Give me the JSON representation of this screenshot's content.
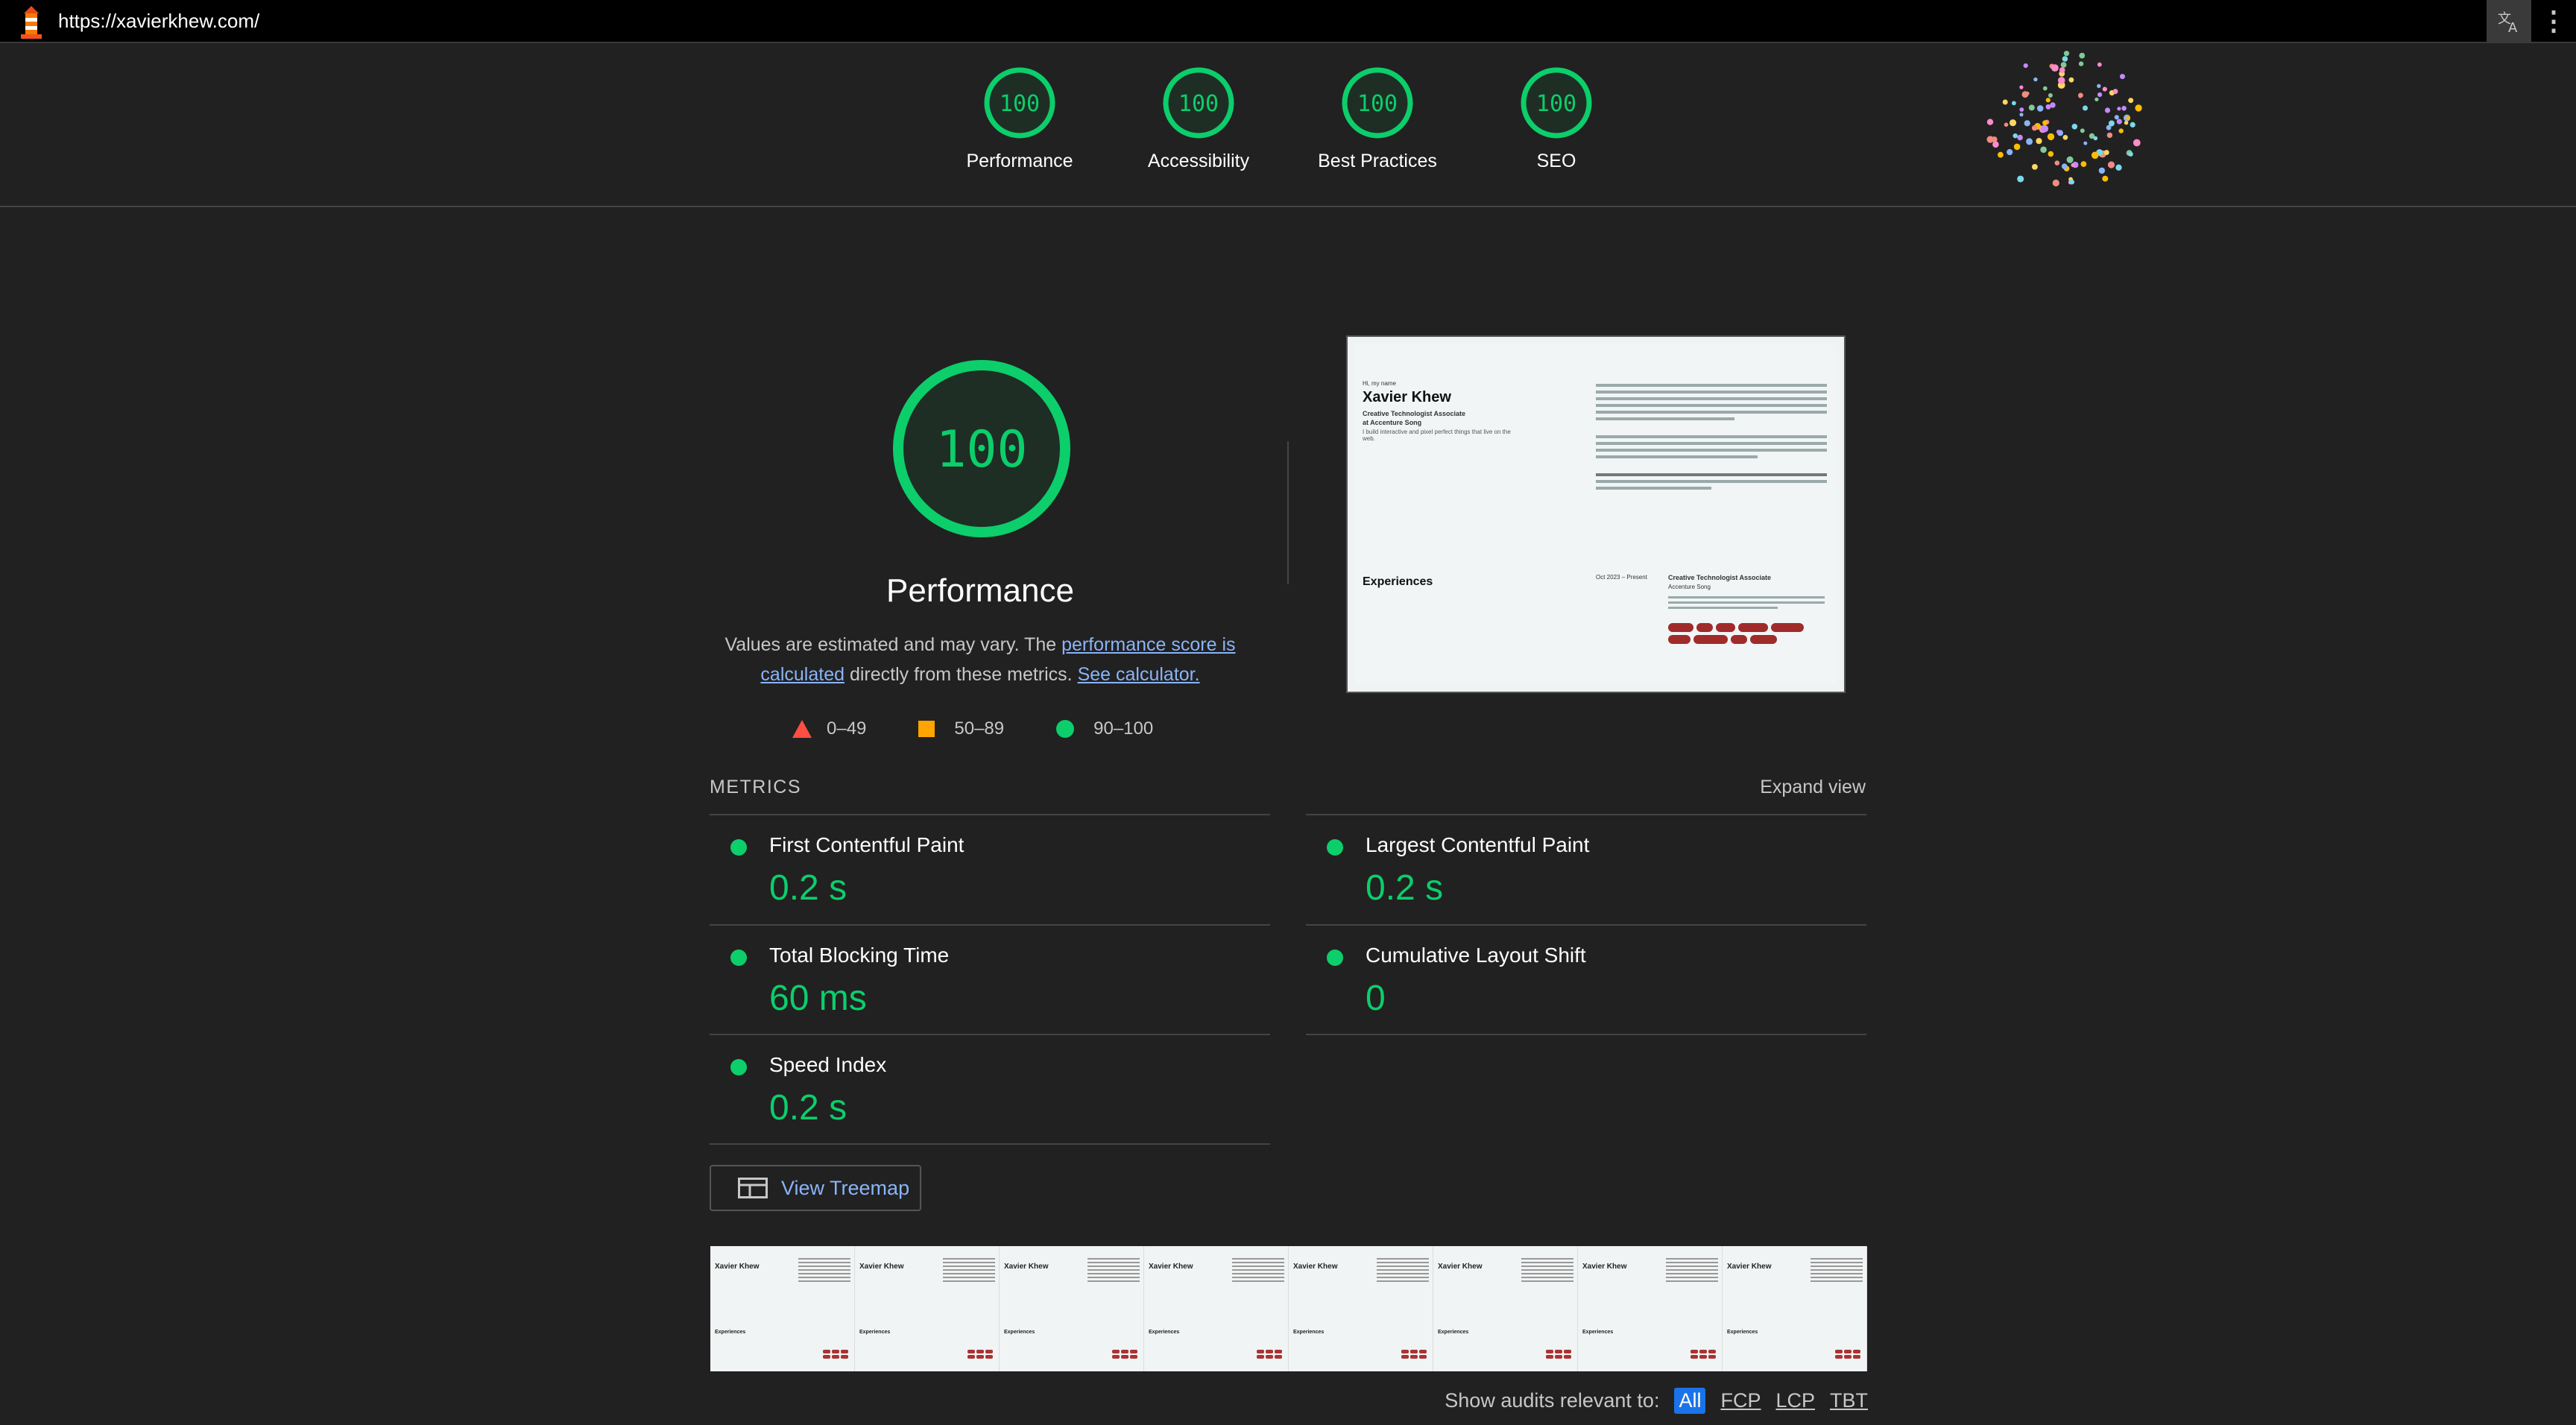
{
  "browser": {
    "url": "https://xavierkhew.com/",
    "translate_icon": "translate-icon",
    "menu_icon": "kebab-menu-icon"
  },
  "header_scores": [
    {
      "label": "Performance",
      "score": "100"
    },
    {
      "label": "Accessibility",
      "score": "100"
    },
    {
      "label": "Best Practices",
      "score": "100"
    },
    {
      "label": "SEO",
      "score": "100"
    }
  ],
  "performance": {
    "score": "100",
    "title": "Performance",
    "desc_prefix": "Values are estimated and may vary. The ",
    "desc_link1": "performance score is calculated",
    "desc_mid": " directly from these metrics. ",
    "desc_link2": "See calculator."
  },
  "legend": [
    {
      "range": "0–49",
      "shape": "triangle",
      "color": "#ff4e42"
    },
    {
      "range": "50–89",
      "shape": "square",
      "color": "#ffa400"
    },
    {
      "range": "90–100",
      "shape": "circle",
      "color": "#0cce6b"
    }
  ],
  "screenshot": {
    "hi": "Hi, my name",
    "name": "Xavier Khew",
    "role1": "Creative Technologist Associate",
    "role2": "at Accenture Song",
    "tagline": "I build interactive and pixel perfect things that live on the web.",
    "experiences": "Experiences",
    "date": "Oct 2023 – Present",
    "job": "Creative Technologist Associate",
    "company": "Accenture Song"
  },
  "metrics": {
    "heading": "METRICS",
    "expand": "Expand view",
    "items": [
      {
        "name": "First Contentful Paint",
        "value": "0.2 s"
      },
      {
        "name": "Largest Contentful Paint",
        "value": "0.2 s"
      },
      {
        "name": "Total Blocking Time",
        "value": "60 ms"
      },
      {
        "name": "Cumulative Layout Shift",
        "value": "0"
      },
      {
        "name": "Speed Index",
        "value": "0.2 s"
      }
    ]
  },
  "treemap": {
    "label": "View Treemap"
  },
  "filmstrip": {
    "frame_title": "Xavier Khew",
    "frame_section": "Experiences"
  },
  "audits_filter": {
    "label": "Show audits relevant to:",
    "options": [
      "All",
      "FCP",
      "LCP",
      "TBT"
    ]
  },
  "colors": {
    "pass": "#0cce6b",
    "link": "#8ab4f8",
    "background": "#212121"
  }
}
